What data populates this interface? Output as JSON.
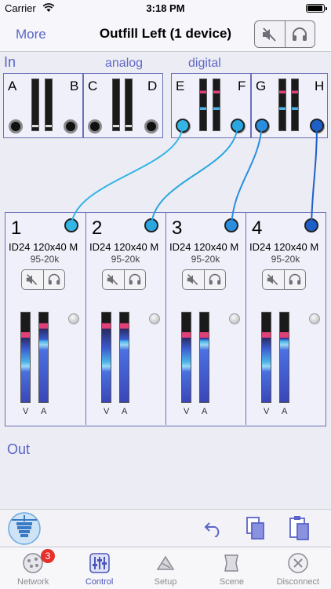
{
  "status_bar": {
    "carrier": "Carrier",
    "time": "3:18 PM"
  },
  "nav": {
    "more_label": "More",
    "title": "Outfill Left (1 device)"
  },
  "sections": {
    "in_label": "In",
    "analog_label": "analog",
    "digital_label": "digital",
    "out_label": "Out"
  },
  "inputs": [
    {
      "letter": "A"
    },
    {
      "letter": "B"
    },
    {
      "letter": "C"
    },
    {
      "letter": "D"
    },
    {
      "letter": "E"
    },
    {
      "letter": "F"
    },
    {
      "letter": "G"
    },
    {
      "letter": "H"
    }
  ],
  "outputs": [
    {
      "number": "1",
      "name": "ID24 120x40 M",
      "range": "95-20k",
      "meter_labels": [
        "V",
        "A"
      ]
    },
    {
      "number": "2",
      "name": "ID24 120x40 M",
      "range": "95-20k",
      "meter_labels": [
        "V",
        "A"
      ]
    },
    {
      "number": "3",
      "name": "ID24 120x40 M",
      "range": "95-20k",
      "meter_labels": [
        "V",
        "A"
      ]
    },
    {
      "number": "4",
      "name": "ID24 120x40 M",
      "range": "95-20k",
      "meter_labels": [
        "V",
        "A"
      ]
    }
  ],
  "icons": {
    "mute": "speaker-mute-icon",
    "solo": "headphones-icon",
    "undo": "undo-arrow-icon",
    "copy": "copy-icon",
    "paste": "paste-icon",
    "logo": "speaker-array-logo-icon"
  },
  "tabs": [
    {
      "label": "Network",
      "badge": "3"
    },
    {
      "label": "Control",
      "active": true
    },
    {
      "label": "Setup"
    },
    {
      "label": "Scene"
    },
    {
      "label": "Disconnect"
    }
  ],
  "colors": {
    "accent": "#5a64c8",
    "cable_light": "#33b5e5",
    "cable_dark": "#1e5fc8",
    "badge": "#e8302a"
  }
}
